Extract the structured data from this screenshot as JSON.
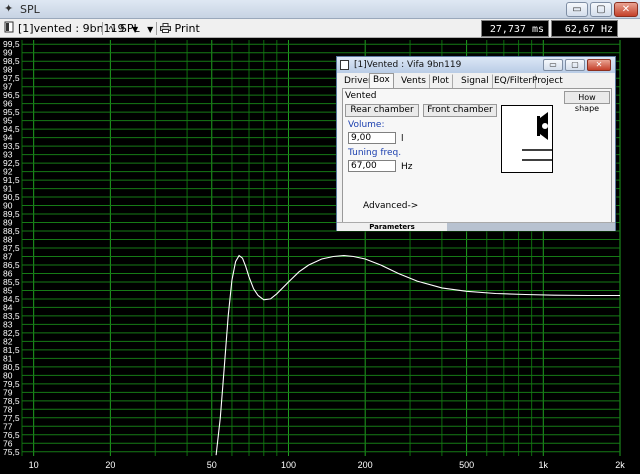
{
  "window": {
    "title": "SPL",
    "minimize": "▭",
    "maximize": "▢",
    "close": "✕"
  },
  "toolbar": {
    "project_selector": "[1]vented : 9bn119",
    "view_selector": "SPL",
    "print_label": "Print",
    "time_readout": "27,737 ms",
    "freq_readout": "62,67 Hz"
  },
  "chart_data": {
    "type": "line",
    "title": "",
    "xlabel": "",
    "ylabel": "",
    "x_scale": "log",
    "xlim": [
      9,
      2000
    ],
    "ylim": [
      75.25,
      99.75
    ],
    "grid": true,
    "x_tick_labels": [
      {
        "value": 10,
        "label": "10"
      },
      {
        "value": 20,
        "label": "20"
      },
      {
        "value": 50,
        "label": "50"
      },
      {
        "value": 100,
        "label": "100"
      },
      {
        "value": 200,
        "label": "200"
      },
      {
        "value": 500,
        "label": "500"
      },
      {
        "value": 1000,
        "label": "1k"
      },
      {
        "value": 2000,
        "label": "2k"
      }
    ],
    "y_tick_labels": [
      "99,5",
      "99",
      "98,5",
      "98",
      "97,5",
      "97",
      "96,5",
      "96",
      "95,5",
      "95",
      "94,5",
      "94",
      "93,5",
      "93",
      "92,5",
      "92",
      "91,5",
      "91",
      "90,5",
      "90",
      "89,5",
      "89",
      "88,5",
      "88",
      "87,5",
      "87",
      "86,5",
      "86",
      "85,5",
      "85",
      "84,5",
      "84",
      "83,5",
      "83",
      "82,5",
      "82",
      "81,5",
      "81",
      "80,5",
      "80",
      "79,5",
      "79",
      "78,5",
      "78",
      "77,5",
      "77",
      "76,5",
      "76",
      "75,5"
    ],
    "series": [
      {
        "color": "#ffffff",
        "x": [
          52,
          54,
          56,
          58,
          60,
          62,
          64,
          66,
          68,
          70,
          73,
          76,
          80,
          85,
          90,
          100,
          110,
          120,
          135,
          150,
          165,
          180,
          200,
          230,
          270,
          320,
          400,
          500,
          650,
          850,
          1100,
          1500,
          2000
        ],
        "y": [
          75.3,
          77.5,
          80.5,
          83.5,
          85.6,
          86.7,
          87.05,
          86.9,
          86.4,
          85.8,
          85.1,
          84.7,
          84.45,
          84.5,
          84.8,
          85.5,
          86.1,
          86.5,
          86.85,
          87.0,
          87.05,
          87.0,
          86.85,
          86.5,
          86.0,
          85.55,
          85.15,
          84.95,
          84.82,
          84.76,
          84.72,
          84.7,
          84.7
        ]
      }
    ]
  },
  "dialog": {
    "title": "[1]Vented : Vifa 9bn119",
    "tabs": [
      "Driver",
      "Box",
      "Vents",
      "Plot",
      "Signal",
      "EQ/Filter",
      "Project"
    ],
    "active_tab": "Box",
    "box_type": "Vented",
    "how_shape_button": "How shape",
    "rear_chamber_button": "Rear chamber",
    "front_chamber_button": "Front chamber",
    "volume_label": "Volume:",
    "volume_value": "9,00",
    "volume_unit": "l",
    "tuning_label": "Tuning freq.",
    "tuning_value": "67,00",
    "tuning_unit": "Hz",
    "advanced_link": "Advanced->",
    "status": "Parameters"
  }
}
